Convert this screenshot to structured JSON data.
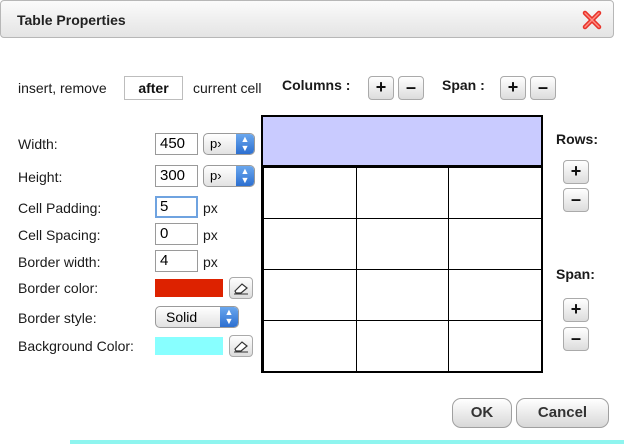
{
  "dialog": {
    "title": "Table Properties",
    "close_icon": "close-x-icon"
  },
  "insert_row": {
    "prefix": "insert, remove",
    "position_value": "after",
    "suffix": "current cell",
    "columns_label": "Columns :",
    "span_label": "Span :",
    "plus": "+",
    "minus": "–"
  },
  "fields": {
    "width_label": "Width:",
    "width_value": "450",
    "width_unit": "p›",
    "height_label": "Height:",
    "height_value": "300",
    "height_unit": "p›",
    "cell_padding_label": "Cell Padding:",
    "cell_padding_value": "5",
    "cell_padding_unit": "px",
    "cell_spacing_label": "Cell Spacing:",
    "cell_spacing_value": "0",
    "cell_spacing_unit": "px",
    "border_width_label": "Border width:",
    "border_width_value": "4",
    "border_width_unit": "px",
    "border_color_label": "Border color:",
    "border_color_value": "#dd2200",
    "border_style_label": "Border style:",
    "border_style_value": "Solid",
    "background_color_label": "Background Color:",
    "background_color_value": "#88ffff"
  },
  "right_panel": {
    "rows_label": "Rows:",
    "span_label": "Span:",
    "plus": "+",
    "minus": "–"
  },
  "preview": {
    "header_color": "#c9cbff",
    "rows": 4,
    "cols": 3
  },
  "footer": {
    "ok_label": "OK",
    "cancel_label": "Cancel"
  }
}
